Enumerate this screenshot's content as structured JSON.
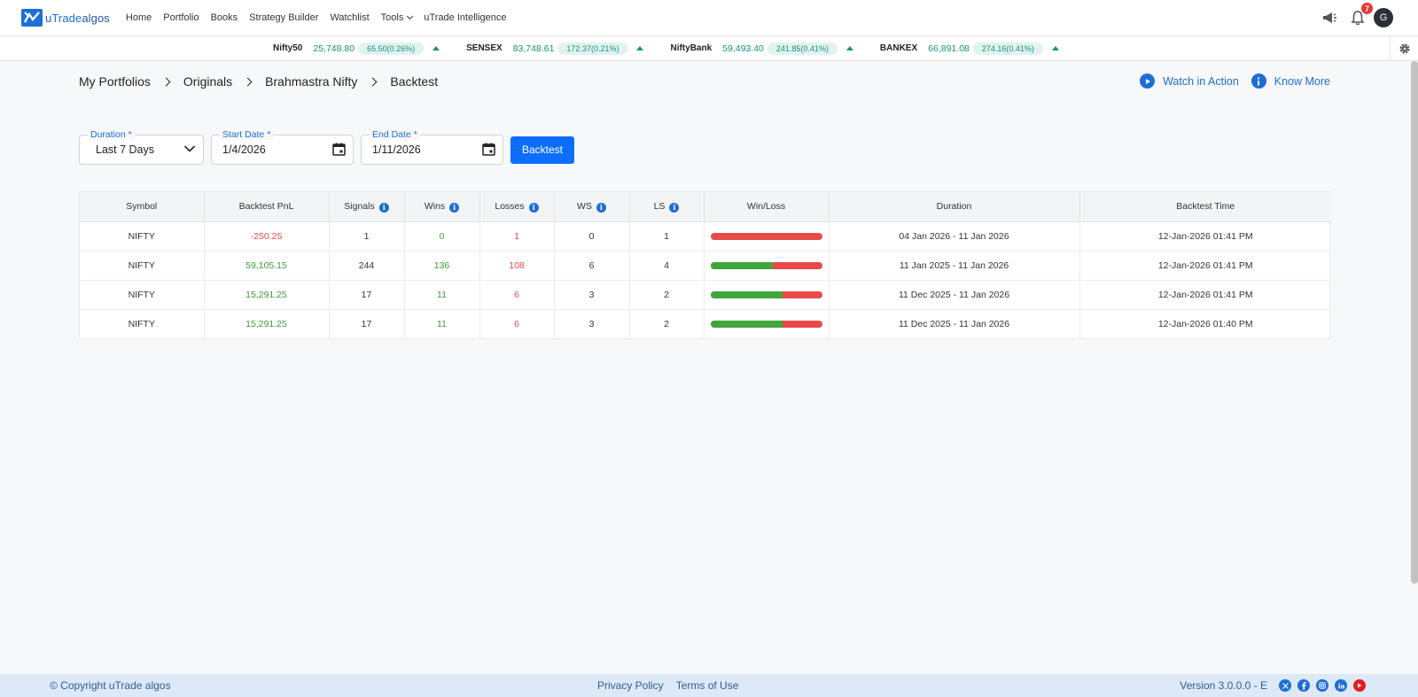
{
  "brand": {
    "name_prefix": "uTrade",
    "name_suffix": "algos"
  },
  "nav": {
    "items": [
      "Home",
      "Portfolio",
      "Books",
      "Strategy Builder",
      "Watchlist",
      "Tools",
      "uTrade Intelligence"
    ],
    "notification_count": "7",
    "avatar_initial": "G"
  },
  "ticker": [
    {
      "name": "Nifty50",
      "price": "25,748.80",
      "change": "65.50(0.26%)"
    },
    {
      "name": "SENSEX",
      "price": "83,748.61",
      "change": "172.37(0.21%)"
    },
    {
      "name": "NiftyBank",
      "price": "59,493.40",
      "change": "241.85(0.41%)"
    },
    {
      "name": "BANKEX",
      "price": "66,891.08",
      "change": "274.16(0.41%)"
    }
  ],
  "breadcrumb": [
    "My Portfolios",
    "Originals",
    "Brahmastra Nifty",
    "Backtest"
  ],
  "actions": {
    "watch": "Watch in Action",
    "know": "Know More"
  },
  "form": {
    "duration_label": "Duration *",
    "duration_value": "Last 7 Days",
    "start_label": "Start Date *",
    "start_value": "1/4/2026",
    "end_label": "End Date *",
    "end_value": "1/11/2026",
    "submit": "Backtest"
  },
  "table": {
    "headers": [
      "Symbol",
      "Backtest PnL",
      "Signals",
      "Wins",
      "Losses",
      "WS",
      "LS",
      "Win/Loss",
      "Duration",
      "Backtest Time"
    ],
    "rows": [
      {
        "symbol": "NIFTY",
        "pnl": "-250.25",
        "pnl_sign": "neg",
        "signals": "1",
        "wins": "0",
        "losses": "1",
        "ws": "0",
        "ls": "1",
        "win_ratio": 0.0,
        "duration": "04 Jan 2026 - 11 Jan 2026",
        "time": "12-Jan-2026 01:41 PM"
      },
      {
        "symbol": "NIFTY",
        "pnl": "59,105.15",
        "pnl_sign": "pos",
        "signals": "244",
        "wins": "136",
        "losses": "108",
        "ws": "6",
        "ls": "4",
        "win_ratio": 0.557,
        "duration": "11 Jan 2025 - 11 Jan 2026",
        "time": "12-Jan-2026 01:41 PM"
      },
      {
        "symbol": "NIFTY",
        "pnl": "15,291.25",
        "pnl_sign": "pos",
        "signals": "17",
        "wins": "11",
        "losses": "6",
        "ws": "3",
        "ls": "2",
        "win_ratio": 0.647,
        "duration": "11 Dec 2025 - 11 Jan 2026",
        "time": "12-Jan-2026 01:41 PM"
      },
      {
        "symbol": "NIFTY",
        "pnl": "15,291.25",
        "pnl_sign": "pos",
        "signals": "17",
        "wins": "11",
        "losses": "6",
        "ws": "3",
        "ls": "2",
        "win_ratio": 0.647,
        "duration": "11 Dec 2025 - 11 Jan 2026",
        "time": "12-Jan-2026 01:40 PM"
      }
    ]
  },
  "footer": {
    "copyright": "© Copyright uTrade algos",
    "privacy": "Privacy Policy",
    "terms": "Terms of Use",
    "version": "Version 3.0.0.0 - E"
  },
  "colors": {
    "primary": "#0d6efd",
    "positive": "#3a9d37",
    "negative": "#e04b4b",
    "ticker_green": "#17927f"
  }
}
